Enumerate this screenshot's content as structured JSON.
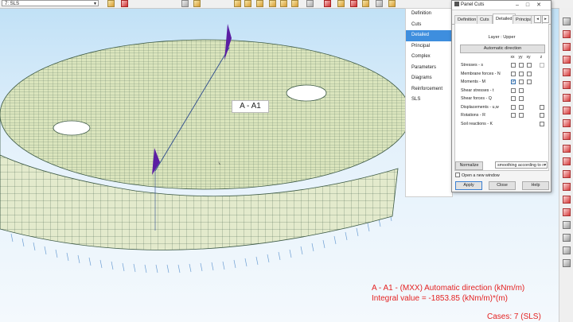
{
  "toolbar": {
    "case_value": "7: SLS"
  },
  "side_nav": {
    "items": [
      {
        "label": "Definition"
      },
      {
        "label": "Cuts"
      },
      {
        "label": "Detailed",
        "active": true
      },
      {
        "label": "Principal"
      },
      {
        "label": "Complex"
      },
      {
        "label": "Parameters"
      },
      {
        "label": "Diagrams"
      },
      {
        "label": "Reinforcement"
      },
      {
        "label": "SLS"
      }
    ]
  },
  "dialog": {
    "title": "Panel Cuts",
    "tabs": [
      "Definition",
      "Cuts",
      "Detailed",
      "Principal",
      "Co"
    ],
    "active_tab": "Detailed",
    "layer_label": "Layer : Upper",
    "auto_direction_label": "Automatic direction",
    "columns": [
      "xx",
      "yy",
      "xy",
      "z"
    ],
    "rows": [
      {
        "label": "Stresses - s"
      },
      {
        "label": "Membrane forces - N"
      },
      {
        "label": "Moments - M",
        "checked": "xx"
      },
      {
        "label": "Shear stresses - t"
      },
      {
        "label": "Shear forces - Q"
      },
      {
        "label": "Displacements - u,w"
      },
      {
        "label": "Rotations - R"
      },
      {
        "label": "Soil reactions - K"
      }
    ],
    "normalize_label": "Normalize",
    "smoothing_value": "smoothing according to s",
    "open_new_window_label": "Open a new window",
    "apply_label": "Apply",
    "close_label": "Close",
    "help_label": "Help"
  },
  "viewport": {
    "cut_label": "A - A1",
    "result_line1": "A - A1 - (MXX) Automatic direction (kNm/m)",
    "result_line2": "Integral value = -1853.85 (kNm/m)*(m)",
    "cases_text": "Cases: 7 (SLS)",
    "result_color": "#e42323"
  }
}
